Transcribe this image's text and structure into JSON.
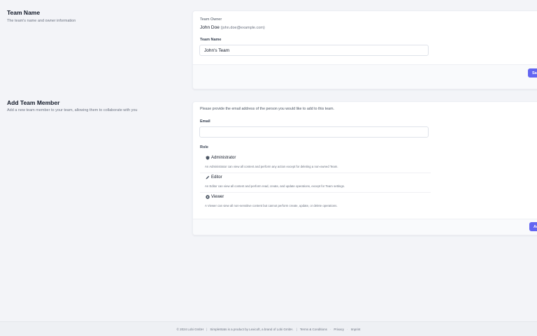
{
  "team_name_section": {
    "title": "Team Name",
    "description": "The team's name and owner information",
    "owner_label": "Team Owner",
    "owner_name": "John Doe",
    "owner_email": "(john.doe@example.com)",
    "name_label": "Team Name",
    "name_value": "John's Team",
    "save_button": "Save"
  },
  "add_member_section": {
    "title": "Add Team Member",
    "description": "Add a new team member to your team, allowing them to collaborate with you",
    "intro": "Please provide the email address of the person you would like to add to this team.",
    "email_label": "Email",
    "email_value": "",
    "role_label": "Role",
    "roles": [
      {
        "name": "Administrator",
        "description": "An Administrator can view all content and perform any action except for deleting a non-owned Team.",
        "icon": "shield-icon"
      },
      {
        "name": "Editor",
        "description": "An Editor can view all content and perform read, create, and update operations, except for Team settings.",
        "icon": "pencil-icon"
      },
      {
        "name": "Viewer",
        "description": "A Viewer can view all non-sensitive content but cannot perform create, update, or delete operations.",
        "icon": "eye-icon"
      }
    ],
    "add_button": "Add"
  },
  "footer": {
    "copyright": "© 2024 Lobi GmbH",
    "product_note": "SimpleStats is a product by Lexicoft, a brand of Lobi GmbH.",
    "links": [
      "Terms & Conditions",
      "Privacy",
      "Imprint"
    ]
  },
  "colors": {
    "accent": "#6366f1",
    "page_bg": "#f3f4f8"
  }
}
